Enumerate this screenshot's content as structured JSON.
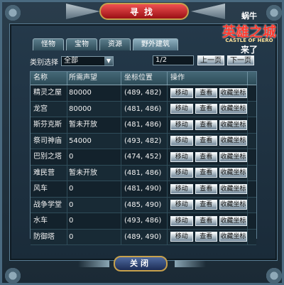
{
  "window": {
    "title": "寻找",
    "close_label": "关闭"
  },
  "logo": {
    "line1": "蜗牛",
    "line2": "英雄之城",
    "line3": "来了",
    "subtitle": "CASTLE OF HERO"
  },
  "tabs": [
    {
      "label": "怪物",
      "active": false
    },
    {
      "label": "宝物",
      "active": false
    },
    {
      "label": "资源",
      "active": false
    },
    {
      "label": "野外建筑",
      "active": true
    }
  ],
  "filter": {
    "label": "类别选择",
    "selected": "全部",
    "page": "1/2",
    "prev_label": "上一页",
    "next_label": "下一页"
  },
  "table": {
    "headers": [
      "名称",
      "所需声望",
      "坐标位置",
      "操作"
    ],
    "action_labels": [
      "移动",
      "查看",
      "收藏坐标"
    ],
    "rows": [
      {
        "name": "精灵之屋",
        "fame": "80000",
        "coord": "(489, 482)"
      },
      {
        "name": "龙宫",
        "fame": "80000",
        "coord": "(481, 486)"
      },
      {
        "name": "斯芬克斯",
        "fame": "暂未开放",
        "coord": "(481, 486)"
      },
      {
        "name": "祭司神庙",
        "fame": "54000",
        "coord": "(493, 482)"
      },
      {
        "name": "巴别之塔",
        "fame": "0",
        "coord": "(474, 452)"
      },
      {
        "name": "难民营",
        "fame": "暂未开放",
        "coord": "(481, 486)"
      },
      {
        "name": "风车",
        "fame": "0",
        "coord": "(481, 490)"
      },
      {
        "name": "战争学堂",
        "fame": "0",
        "coord": "(485, 490)"
      },
      {
        "name": "水车",
        "fame": "0",
        "coord": "(493, 486)"
      },
      {
        "name": "防御塔",
        "fame": "0",
        "coord": "(489, 490)"
      }
    ]
  }
}
